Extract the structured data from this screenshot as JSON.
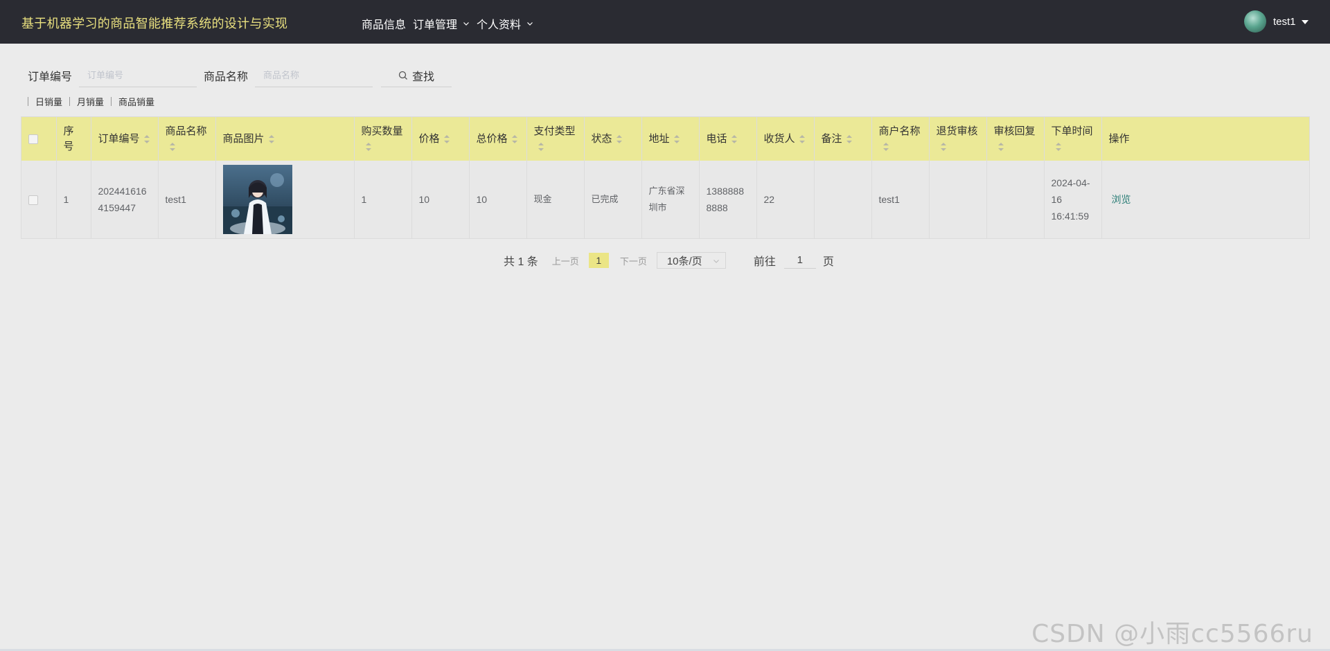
{
  "header": {
    "title": "基于机器学习的商品智能推荐系统的设计与实现",
    "nav": [
      {
        "label": "商品信息",
        "has_dropdown": false
      },
      {
        "label": "订单管理",
        "has_dropdown": true
      },
      {
        "label": "个人资料",
        "has_dropdown": true
      }
    ],
    "user": {
      "name": "test1"
    }
  },
  "search": {
    "order_no_label": "订单编号",
    "order_no_placeholder": "订单编号",
    "order_no_value": "",
    "product_name_label": "商品名称",
    "product_name_placeholder": "商品名称",
    "product_name_value": "",
    "search_button": "查找"
  },
  "chart_links": [
    "日销量",
    "月销量",
    "商品销量"
  ],
  "table": {
    "columns": [
      "序号",
      "订单编号",
      "商品名称",
      "商品图片",
      "购买数量",
      "价格",
      "总价格",
      "支付类型",
      "状态",
      "地址",
      "电话",
      "收货人",
      "备注",
      "商户名称",
      "退货审核",
      "审核回复",
      "下单时间",
      "操作"
    ],
    "rows": [
      {
        "index": "1",
        "order_no": "2024416164159447",
        "product_name": "test1",
        "quantity": "1",
        "price": "10",
        "total_price": "10",
        "payment_type": "现金",
        "status": "已完成",
        "address": "广东省深圳市",
        "phone": "13888888888",
        "receiver": "22",
        "remark": "",
        "merchant": "test1",
        "return_review": "",
        "review_reply": "",
        "order_time": "2024-04-16 16:41:59",
        "action": "浏览"
      }
    ]
  },
  "pagination": {
    "total": "共 1 条",
    "prev": "上一页",
    "current": "1",
    "next": "下一页",
    "page_size": "10条/页",
    "goto_label": "前往",
    "goto_value": "1",
    "page_suffix": "页"
  },
  "watermark": "CSDN @小雨cc5566ru"
}
